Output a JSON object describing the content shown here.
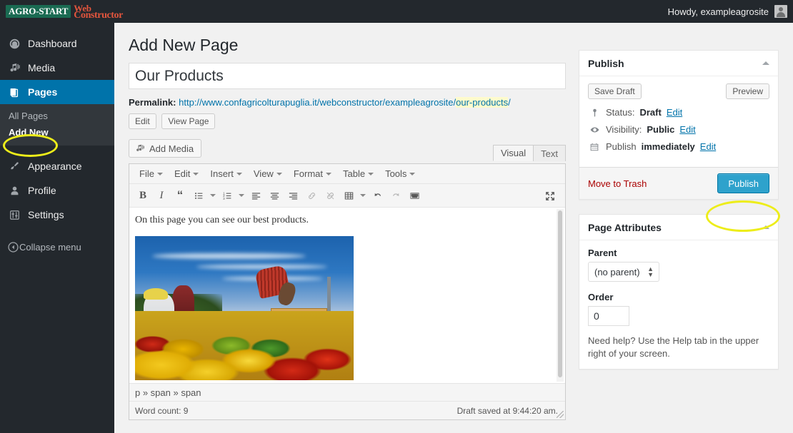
{
  "adminbar": {
    "logo_agro": "AGRO-START",
    "logo_web_line1": "Web",
    "logo_web_line2": "Constructor",
    "howdy": "Howdy, exampleagrosite",
    "avatar_icon": "user-avatar-icon"
  },
  "sidebar": {
    "items": [
      {
        "label": "Dashboard",
        "icon": "dashboard-icon"
      },
      {
        "label": "Media",
        "icon": "media-icon"
      },
      {
        "label": "Pages",
        "icon": "pages-icon"
      }
    ],
    "submenu": [
      {
        "label": "All Pages"
      },
      {
        "label": "Add New"
      }
    ],
    "items2": [
      {
        "label": "Appearance",
        "icon": "appearance-brush-icon"
      },
      {
        "label": "Profile",
        "icon": "profile-user-icon"
      },
      {
        "label": "Settings",
        "icon": "settings-sliders-icon"
      }
    ],
    "collapse": {
      "label": "Collapse menu",
      "icon": "collapse-arrow-icon"
    }
  },
  "main": {
    "page_title": "Add New Page",
    "title_value": "Our Products",
    "title_placeholder": "Enter title here",
    "permalink": {
      "label": "Permalink:",
      "base": "http://www.confagricolturapuglia.it/webconstructor/exampleagrosite/",
      "slug": "our-products",
      "trailing": "/"
    },
    "edit_button": "Edit",
    "view_page_button": "View Page",
    "add_media_button": "Add Media",
    "add_media_icon": "media-icon",
    "tabs": [
      {
        "label": "Visual",
        "active": true
      },
      {
        "label": "Text",
        "active": false
      }
    ]
  },
  "editor": {
    "menubar": [
      "File",
      "Edit",
      "Insert",
      "View",
      "Format",
      "Table",
      "Tools"
    ],
    "toolbar": [
      {
        "name": "bold-icon",
        "glyph": "B"
      },
      {
        "name": "italic-icon",
        "glyph": "I"
      },
      {
        "name": "blockquote-icon",
        "glyph": "“"
      },
      {
        "name": "bullet-list-icon",
        "glyph": ""
      },
      {
        "name": "numbered-list-icon",
        "glyph": ""
      },
      {
        "name": "align-left-icon",
        "glyph": ""
      },
      {
        "name": "align-center-icon",
        "glyph": ""
      },
      {
        "name": "align-right-icon",
        "glyph": ""
      },
      {
        "name": "link-icon",
        "glyph": ""
      },
      {
        "name": "unlink-icon",
        "glyph": ""
      },
      {
        "name": "table-icon",
        "glyph": ""
      },
      {
        "name": "undo-icon",
        "glyph": ""
      },
      {
        "name": "redo-icon",
        "glyph": ""
      },
      {
        "name": "keyboard-shortcuts-icon",
        "glyph": ""
      },
      {
        "name": "fullscreen-icon",
        "glyph": ""
      }
    ],
    "body_text": "On this page you can see our best products.",
    "image_alt": "Farm workers harvesting yellow and red bell peppers into wooden crates",
    "path": "p » span » span",
    "word_count": "Word count: 9",
    "draft_saved": "Draft saved at 9:44:20 am."
  },
  "publish": {
    "title": "Publish",
    "save_draft": "Save Draft",
    "preview": "Preview",
    "status_label": "Status:",
    "status_value": "Draft",
    "status_edit": "Edit",
    "status_icon": "pin-marker-icon",
    "visibility_label": "Visibility:",
    "visibility_value": "Public",
    "visibility_edit": "Edit",
    "visibility_icon": "eye-icon",
    "publish_label": "Publish",
    "publish_value": "immediately",
    "publish_edit": "Edit",
    "publish_icon": "calendar-icon",
    "move_to_trash": "Move to Trash",
    "publish_button": "Publish"
  },
  "page_attributes": {
    "title": "Page Attributes",
    "parent_label": "Parent",
    "parent_value": "(no parent)",
    "parent_options": [
      "(no parent)"
    ],
    "order_label": "Order",
    "order_value": "0",
    "help_text": "Need help? Use the Help tab in the upper right of your screen."
  },
  "annotations": {
    "highlight_color": "#eded1a",
    "targets": [
      "add-new-menu-item",
      "publish-button"
    ]
  },
  "colors": {
    "admin_bar": "#23282d",
    "sidebar": "#23282d",
    "submenu": "#32373c",
    "current_menu": "#0073aa",
    "primary_button": "#2ea2cc",
    "slug_highlight": "#fffbcc",
    "trash_link": "#a00",
    "link": "#0073aa"
  }
}
